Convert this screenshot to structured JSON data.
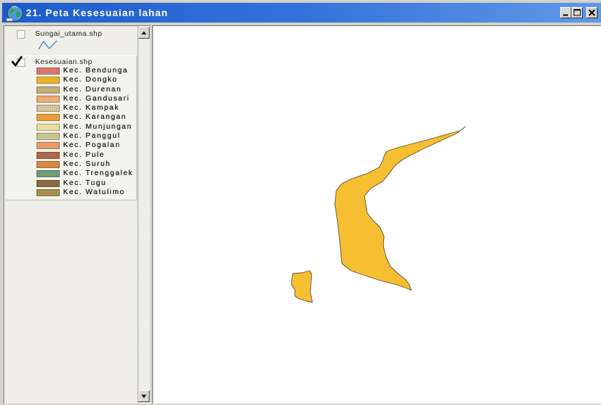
{
  "window": {
    "title": "21. Peta Kesesuaian lahan",
    "app_icon": "view-globe-icon",
    "controls": [
      "minimize-icon",
      "maximize-icon",
      "close-icon"
    ]
  },
  "toc": {
    "layers": [
      {
        "name": "Sungai_utama.shp",
        "visible": false,
        "symbol": {
          "icon": "river-line-symbol-icon",
          "color": "#3b7ad6"
        }
      },
      {
        "name": "Kesesuaian.shp",
        "visible": true,
        "legend": [
          {
            "label": "Kec. Bendunga",
            "color": "#e07872"
          },
          {
            "label": "Kec. Dongko",
            "color": "#f3b62a"
          },
          {
            "label": "Kec. Durenan",
            "color": "#c9b27a"
          },
          {
            "label": "Kec. Gandusari",
            "color": "#f2b07a"
          },
          {
            "label": "Kec. Kampak",
            "color": "#d9c9a2"
          },
          {
            "label": "Kec. Karangan",
            "color": "#f0a23c"
          },
          {
            "label": "Kec. Munjungan",
            "color": "#efe2a6"
          },
          {
            "label": "Kec. Panggul",
            "color": "#cfc995"
          },
          {
            "label": "Kec. Pogalan",
            "color": "#ee9e70"
          },
          {
            "label": "Kec. Pule",
            "color": "#b06a4c"
          },
          {
            "label": "Kec. Suruh",
            "color": "#d98d45"
          },
          {
            "label": "Kec. Trenggalek",
            "color": "#6fa37a"
          },
          {
            "label": "Kec. Tugu",
            "color": "#8b6d45"
          },
          {
            "label": "Kec. Watulimo",
            "color": "#a8944e"
          }
        ]
      }
    ],
    "scrollbar": {
      "up_icon": "scroll-up-arrow-icon",
      "down_icon": "scroll-down-arrow-icon"
    }
  },
  "map": {
    "background": "#ffffff",
    "feature_fill": "#f6bf31",
    "feature_stroke": "#5a4a2c"
  }
}
